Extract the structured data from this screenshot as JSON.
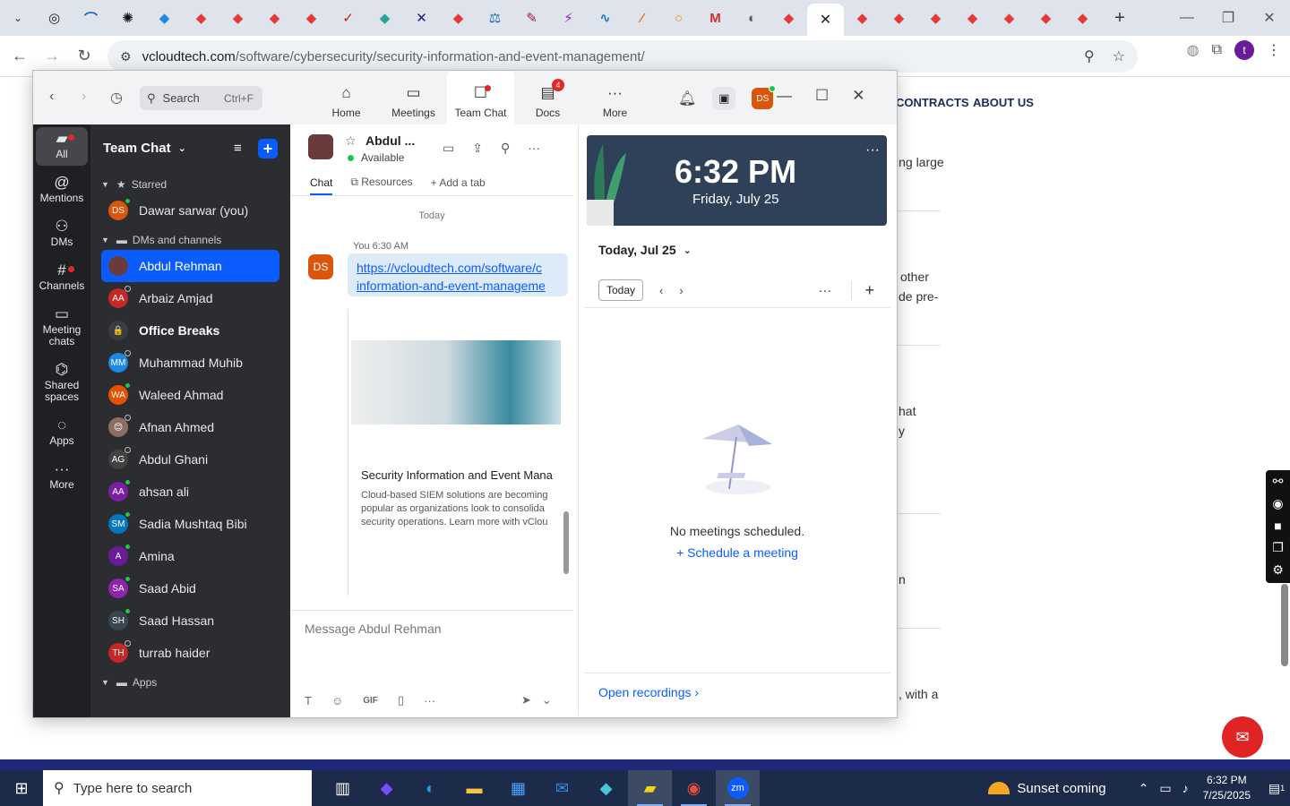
{
  "browser": {
    "url_main": "vcloudtech.com",
    "url_path": "/software/cybersecurity/security-information-and-event-management/",
    "profile_initial": "t",
    "tabs": [
      {
        "icon": "ring-icon",
        "color": "#222222",
        "glyph": "◎"
      },
      {
        "icon": "wifi-icon",
        "color": "#0a66c2",
        "glyph": "⌒"
      },
      {
        "icon": "openai-icon",
        "color": "#111111",
        "glyph": "✺"
      },
      {
        "icon": "tag-icon",
        "color": "#1e88e5",
        "glyph": "◆"
      },
      {
        "icon": "diamond-icon",
        "color": "#e53935",
        "glyph": "◆"
      },
      {
        "icon": "diamond-icon",
        "color": "#e53935",
        "glyph": "◆"
      },
      {
        "icon": "diamond-icon",
        "color": "#e53935",
        "glyph": "◆"
      },
      {
        "icon": "diamond-icon",
        "color": "#e53935",
        "glyph": "◆"
      },
      {
        "icon": "check-icon",
        "color": "#b71c1c",
        "glyph": "✓"
      },
      {
        "icon": "gem-icon",
        "color": "#26a69a",
        "glyph": "◆"
      },
      {
        "icon": "x-icon",
        "color": "#1a237e",
        "glyph": "✕"
      },
      {
        "icon": "diamond-icon",
        "color": "#e53935",
        "glyph": "◆"
      },
      {
        "icon": "scale-icon",
        "color": "#1565c0",
        "glyph": "⚖"
      },
      {
        "icon": "pen-icon",
        "color": "#ad1457",
        "glyph": "✎"
      },
      {
        "icon": "bolt-icon",
        "color": "#8e24aa",
        "glyph": "⚡"
      },
      {
        "icon": "pulse-icon",
        "color": "#1976d2",
        "glyph": "∿"
      },
      {
        "icon": "slash-icon",
        "color": "#ef6c00",
        "glyph": "⁄"
      },
      {
        "icon": "circle-icon",
        "color": "#fb8c00",
        "glyph": "○"
      },
      {
        "icon": "gmail-icon",
        "color": "#d32f2f",
        "glyph": "M"
      },
      {
        "icon": "globe-icon",
        "color": "#555555",
        "glyph": "◐"
      },
      {
        "icon": "diamond-icon",
        "color": "#e53935",
        "glyph": "◆"
      }
    ],
    "tabs_after": [
      {
        "icon": "diamond-icon",
        "color": "#e53935",
        "glyph": "◆"
      },
      {
        "icon": "diamond-icon",
        "color": "#e53935",
        "glyph": "◆"
      },
      {
        "icon": "diamond-icon",
        "color": "#e53935",
        "glyph": "◆"
      },
      {
        "icon": "diamond-icon",
        "color": "#e53935",
        "glyph": "◆"
      },
      {
        "icon": "diamond-icon",
        "color": "#e53935",
        "glyph": "◆"
      },
      {
        "icon": "diamond-icon",
        "color": "#e53935",
        "glyph": "◆"
      },
      {
        "icon": "diamond-icon",
        "color": "#e53935",
        "glyph": "◆"
      }
    ]
  },
  "webpage": {
    "nav_contracts": "CONTRACTS",
    "nav_about": "ABOUT US",
    "fragments": [
      "ing large",
      "other",
      "de pre-",
      "hat",
      "y",
      "n",
      ", with a"
    ]
  },
  "zoom": {
    "search_placeholder": "Search",
    "search_shortcut": "Ctrl+F",
    "tabs": [
      {
        "label": "Home",
        "icon": "⌂"
      },
      {
        "label": "Meetings",
        "icon": "▭"
      },
      {
        "label": "Team Chat",
        "icon": "💬"
      },
      {
        "label": "Docs",
        "icon": "▤",
        "count": "4"
      },
      {
        "label": "More",
        "icon": "···"
      }
    ],
    "avatar_initials": "DS",
    "rail": [
      {
        "label": "All",
        "icon": "▰"
      },
      {
        "label": "Mentions",
        "icon": "@"
      },
      {
        "label": "DMs",
        "icon": "⚇"
      },
      {
        "label": "Channels",
        "icon": "#"
      },
      {
        "label": "Meeting chats",
        "icon": "▭"
      },
      {
        "label": "Shared spaces",
        "icon": "⌬"
      },
      {
        "label": "Apps",
        "icon": "◌"
      },
      {
        "label": "More",
        "icon": "···"
      }
    ],
    "list_title": "Team Chat",
    "section_starred": "Starred",
    "section_dms": "DMs and channels",
    "section_apps": "Apps",
    "starred": [
      {
        "name": "Dawar sarwar (you)",
        "initials": "DS",
        "color": "#d9560c",
        "status": "#1ec74a"
      }
    ],
    "contacts": [
      {
        "name": "Abdul Rehman",
        "initials": "",
        "color": "#6b3b3b",
        "status": "",
        "selected": true
      },
      {
        "name": "Arbaiz Amjad",
        "initials": "AA",
        "color": "#c62828",
        "status": "#2c2d31"
      },
      {
        "name": "Office Breaks",
        "initials": "🔒",
        "color": "#3b3c40",
        "status": "",
        "bold": true
      },
      {
        "name": "Muhammad Muhib",
        "initials": "MM",
        "color": "#1e88e5",
        "status": "#2c2d31"
      },
      {
        "name": "Waleed Ahmad",
        "initials": "WA",
        "color": "#e65100",
        "status": "#1ec74a"
      },
      {
        "name": "Afnan Ahmed",
        "initials": "😊",
        "color": "#8d6e63",
        "status": "#2c2d31"
      },
      {
        "name": "Abdul Ghani",
        "initials": "AG",
        "color": "#424242",
        "status": "#2c2d31"
      },
      {
        "name": "ahsan ali",
        "initials": "AA",
        "color": "#7b1fa2",
        "status": "#1ec74a"
      },
      {
        "name": "Sadia Mushtaq Bibi",
        "initials": "SM",
        "color": "#0277bd",
        "status": "#1ec74a"
      },
      {
        "name": "Amina",
        "initials": "A",
        "color": "#6a1b9a",
        "status": "#1ec74a"
      },
      {
        "name": "Saad Abid",
        "initials": "SA",
        "color": "#8e24aa",
        "status": "#1ec74a"
      },
      {
        "name": "Saad Hassan",
        "initials": "SH",
        "color": "#37474f",
        "status": "#1ec74a"
      },
      {
        "name": "turrab haider",
        "initials": "TH",
        "color": "#c62828",
        "status": "#2c2d31"
      }
    ],
    "chat": {
      "contact_name": "Abdul ...",
      "presence": "Available",
      "tab_chat": "Chat",
      "tab_resources": "Resources",
      "tab_add": "Add a tab",
      "day_label": "Today",
      "msg_meta": "You 6:30 AM",
      "msg_initials": "DS",
      "link_line1": "https://vcloudtech.com/software/c",
      "link_line2": "information-and-event-manageme",
      "preview_title": "Security Information and Event Mana",
      "preview_desc1": "Cloud-based SIEM solutions are becoming",
      "preview_desc2": "popular as organizations look to consolida",
      "preview_desc3": "security operations. Learn more with vClou",
      "composer_placeholder": "Message Abdul Rehman",
      "gif_label": "GIF"
    },
    "calendar": {
      "time": "6:32 PM",
      "date": "Friday, July 25",
      "header": "Today, Jul 25",
      "today_button": "Today",
      "empty_text": "No meetings scheduled.",
      "schedule_link": "Schedule a meeting",
      "open_recordings": "Open recordings"
    }
  },
  "taskbar": {
    "search_placeholder": "Type here to search",
    "weather": "Sunset coming",
    "clock_time": "6:32 PM",
    "clock_date": "7/25/2025",
    "notif_count": "1"
  }
}
